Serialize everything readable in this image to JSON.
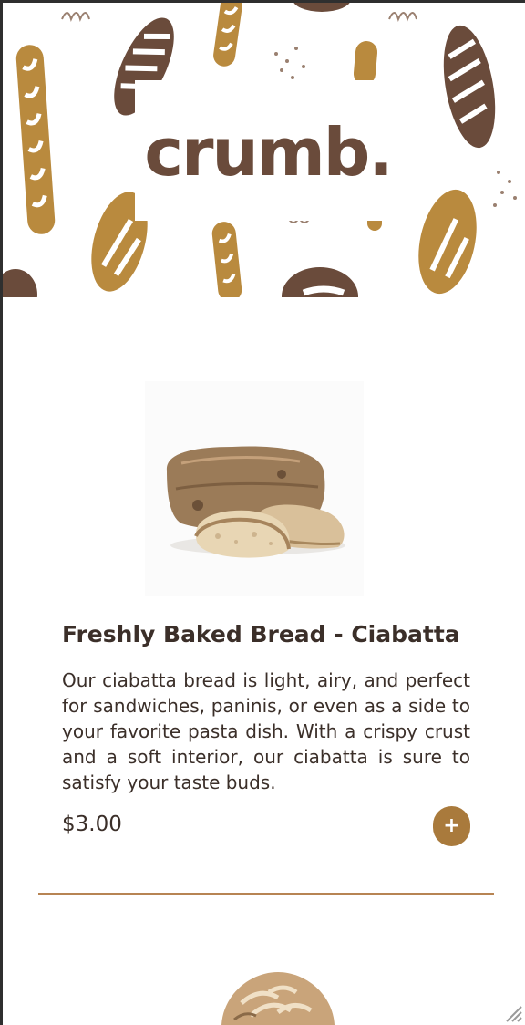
{
  "brand": {
    "logo_text": "crumb.",
    "colors": {
      "brown_dark": "#6a4b3b",
      "gold": "#b98a3e",
      "accent": "#a97a3c",
      "divider": "#b78453",
      "text": "#3b2f29"
    }
  },
  "hero": {
    "pattern": "bread-loaf-illustration-pattern"
  },
  "product": {
    "image_icon": "ciabatta-bread-photo",
    "title": "Freshly Baked Bread - Ciabatta",
    "description": "Our ciabatta bread is light, airy, and perfect for sandwiches, paninis, or even as a side to your favorite pasta dish. With a crispy crust and a soft interior, our ciabatta is sure to satisfy your taste buds.",
    "price": "$3.00",
    "add_label": "+"
  },
  "next_product": {
    "image_icon": "round-bread-loaf-photo"
  }
}
